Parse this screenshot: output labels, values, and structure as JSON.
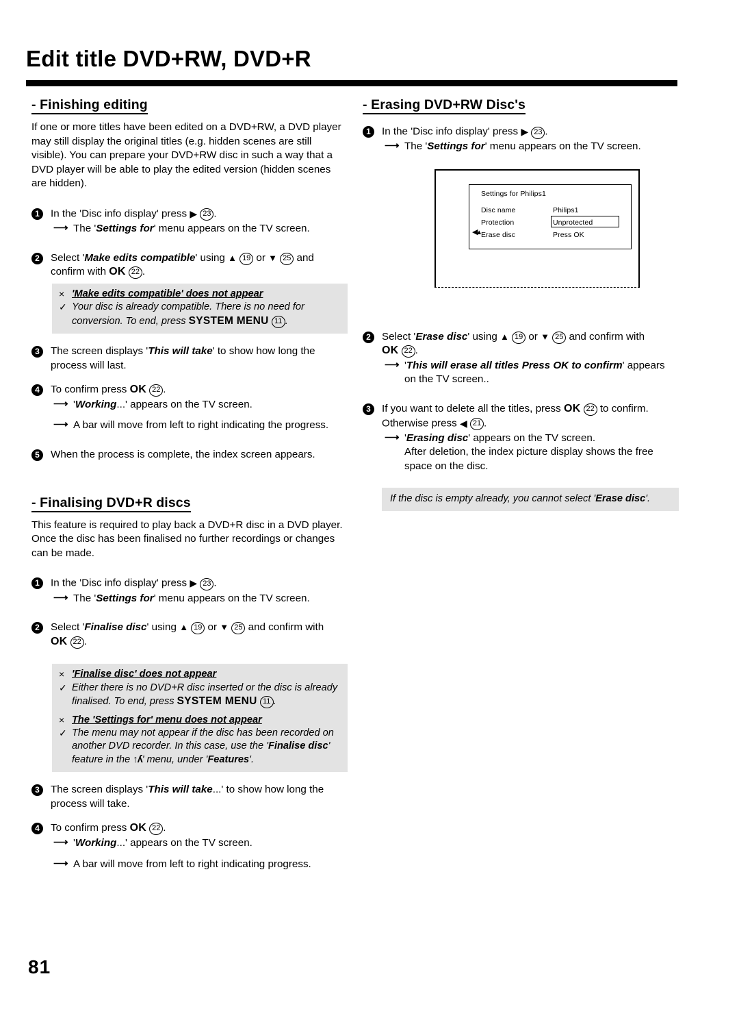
{
  "header": {
    "title": "Edit title DVD+RW, DVD+R"
  },
  "page_number": "81",
  "left_column": {
    "section1": {
      "heading": "- Finishing editing",
      "intro": "If one or more titles have been edited on a DVD+RW, a DVD player may still display the original titles (e.g. hidden scenes are still visible). You can prepare your DVD+RW disc in such a way that a DVD player will be able to play the edited version (hidden scenes are hidden).",
      "step1": {
        "num": "1",
        "text_a": "In the 'Disc info display' press",
        "icon": "▶",
        "ref": "23",
        "text_b": ".",
        "sub_a": "The '",
        "sub_em": "Settings for",
        "sub_b": "' menu appears on the TV screen."
      },
      "step2": {
        "num": "2",
        "text_a": "Select '",
        "em": "Make edits compatible",
        "text_b": "' using",
        "up_icon": "▲",
        "up_ref": "19",
        "or": "or",
        "down_icon": "▼",
        "down_ref": "25",
        "text_c": "and confirm with",
        "ok": "OK",
        "ok_ref": "22",
        "text_d": "."
      },
      "note1": {
        "mark_x": "×",
        "head_quote_open": "'",
        "head_em": "Make edits compatible",
        "head_rest": "' does not appear",
        "mark_check": "✓",
        "body_a": "Your disc is already compatible. There is no need for conversion. To end, press",
        "body_key": "SYSTEM MENU",
        "body_ref": "11",
        "body_b": "."
      },
      "step3": {
        "num": "3",
        "text_a": "The screen displays '",
        "em": "This will take",
        "text_b": "' to show how long the process will last."
      },
      "step4": {
        "num": "4",
        "text_a": "To confirm press",
        "ok": "OK",
        "ok_ref": "22",
        "text_b": ".",
        "sub1_a": "'",
        "sub1_em": "Working",
        "sub1_b": "...' appears on the TV screen.",
        "sub2": "A bar will move from left to right indicating the progress."
      },
      "step5": {
        "num": "5",
        "text": "When the process is complete, the index screen appears."
      }
    },
    "section2": {
      "heading": "- Finalising DVD+R discs",
      "intro": "This feature is required to play back a DVD+R disc in a DVD player. Once the disc has been finalised no further recordings or changes can be made.",
      "step1": {
        "num": "1",
        "text_a": "In the 'Disc info display' press",
        "icon": "▶",
        "ref": "23",
        "text_b": ".",
        "sub_a": "The '",
        "sub_em": "Settings for",
        "sub_b": "' menu appears on the TV screen."
      },
      "step2": {
        "num": "2",
        "text_a": "Select '",
        "em": "Finalise disc",
        "text_b": "' using",
        "up_icon": "▲",
        "up_ref": "19",
        "or": "or",
        "down_icon": "▼",
        "down_ref": "25",
        "text_c": "and confirm with",
        "ok": "OK",
        "ok_ref": "22",
        "text_d": "."
      },
      "note2": {
        "mark_x": "×",
        "head1_quote": "'",
        "head1_em": "Finalise disc",
        "head1_rest": "' does not appear",
        "mark_check": "✓",
        "body1_a": "Either there is no DVD+R disc inserted or the disc is already finalised. To end, press",
        "body1_key": "SYSTEM MENU",
        "body1_ref": "11",
        "body1_b": ".",
        "head2_a": "The '",
        "head2_em": "Settings for",
        "head2_b": "' menu does not appear",
        "body2_a": "The menu may not appear if the disc has been recorded on another DVD recorder. In this case, use the '",
        "body2_em1": "Finalise disc",
        "body2_b": "' feature in the",
        "tools_icon": "↑ʎ",
        "body2_c": "' menu, under '",
        "body2_em2": "Features",
        "body2_d": "'."
      },
      "step3": {
        "num": "3",
        "text_a": "The screen displays '",
        "em": "This will take",
        "text_b": "...' to show how long the process will take."
      },
      "step4": {
        "num": "4",
        "text_a": "To confirm press",
        "ok": "OK",
        "ok_ref": "22",
        "text_b": ".",
        "sub1_a": "'",
        "sub1_em": "Working",
        "sub1_b": "...' appears on the TV screen.",
        "sub2": "A bar will move from left to right indicating progress."
      }
    }
  },
  "right_column": {
    "section": {
      "heading": "- Erasing DVD+RW Disc's",
      "step1": {
        "num": "1",
        "text_a": "In the 'Disc info display' press",
        "icon": "▶",
        "ref": "23",
        "text_b": ".",
        "sub_a": "The '",
        "sub_em": "Settings for",
        "sub_b": "' menu appears on the TV screen."
      },
      "tv_screen": {
        "osd_title": "Settings for Philips1",
        "rows": [
          {
            "label": "Disc name",
            "value": "Philips1"
          },
          {
            "label": "Protection",
            "value": "Unprotected"
          },
          {
            "label": "Erase disc",
            "value": "Press OK"
          }
        ],
        "cursor": "◀▴"
      },
      "step2": {
        "num": "2",
        "text_a": "Select '",
        "em": "Erase disc",
        "text_b": "' using",
        "up_icon": "▲",
        "up_ref": "19",
        "or": "or",
        "down_icon": "▼",
        "down_ref": "25",
        "text_c": "and confirm with",
        "ok": "OK",
        "ok_ref": "22",
        "text_d": ".",
        "sub_a": "'",
        "sub_em": "This will erase all titles  Press OK to confirm",
        "sub_b": "' appears on the TV screen.."
      },
      "step3": {
        "num": "3",
        "text_a": "If you want to delete all the titles, press",
        "ok": "OK",
        "ok_ref": "22",
        "text_b": "to confirm. Otherwise press",
        "left_icon": "◀",
        "left_ref": "21",
        "text_c": ".",
        "sub_a": "'",
        "sub_em": "Erasing disc",
        "sub_b": "' appears on the TV screen.",
        "sub_cont": "After deletion, the index picture display shows the free space on the disc."
      },
      "tip": {
        "text_a": "If the disc is empty already, you cannot select '",
        "em": "Erase disc",
        "text_b": "'."
      }
    }
  },
  "colors": {
    "note_bg": "#e3e3e3",
    "ink": "#000000",
    "paper": "#ffffff"
  }
}
